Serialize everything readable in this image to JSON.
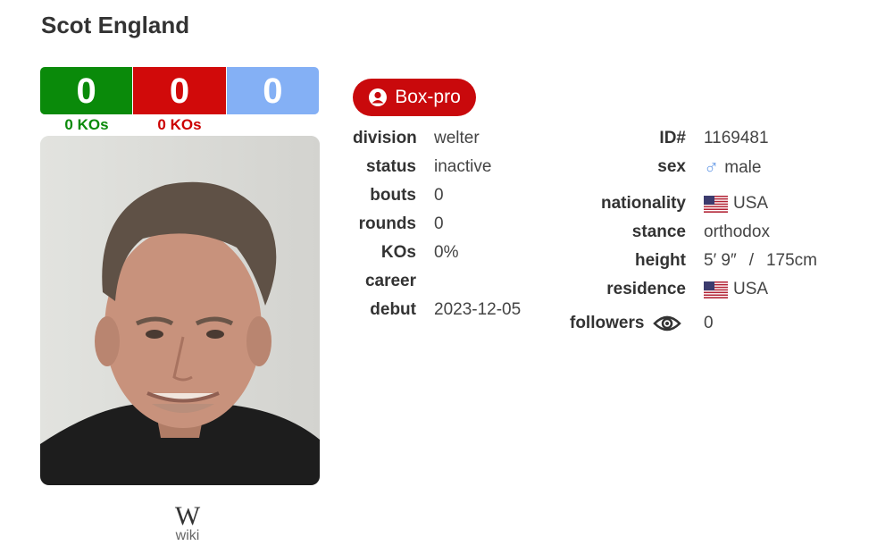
{
  "boxer": {
    "name": "Scot England"
  },
  "record": {
    "wins": "0",
    "losses": "0",
    "draws": "0",
    "win_kos": "0 KOs",
    "loss_kos": "0 KOs"
  },
  "badge": {
    "label": "Box-pro"
  },
  "wiki": {
    "label": "wiki",
    "glyph": "W"
  },
  "details_left": {
    "division": {
      "label": "division",
      "value": "welter"
    },
    "status": {
      "label": "status",
      "value": "inactive"
    },
    "bouts": {
      "label": "bouts",
      "value": "0"
    },
    "rounds": {
      "label": "rounds",
      "value": "0"
    },
    "kos": {
      "label": "KOs",
      "value": "0%"
    },
    "career": {
      "label": "career",
      "value": ""
    },
    "debut": {
      "label": "debut",
      "value": "2023-12-05"
    }
  },
  "details_right": {
    "id": {
      "label": "ID#",
      "value": "1169481"
    },
    "sex": {
      "label": "sex",
      "value": "male",
      "symbol": "♂"
    },
    "nationality": {
      "label": "nationality",
      "value": "USA"
    },
    "stance": {
      "label": "stance",
      "value": "orthodox"
    },
    "height": {
      "label": "height",
      "imperial": "5′ 9″",
      "sep": "/",
      "metric": "175cm"
    },
    "residence": {
      "label": "residence",
      "value": "USA"
    },
    "followers": {
      "label": "followers",
      "value": "0"
    }
  },
  "colors": {
    "win": "#0a8a0a",
    "loss": "#d10a0a",
    "draw": "#84b0f5",
    "badge": "#c9090c",
    "male": "#6fa0e8"
  },
  "icons": {
    "badge": "user-circle-icon",
    "followers": "eye-icon",
    "flag": "us-flag-icon",
    "sex": "male-symbol-icon"
  }
}
